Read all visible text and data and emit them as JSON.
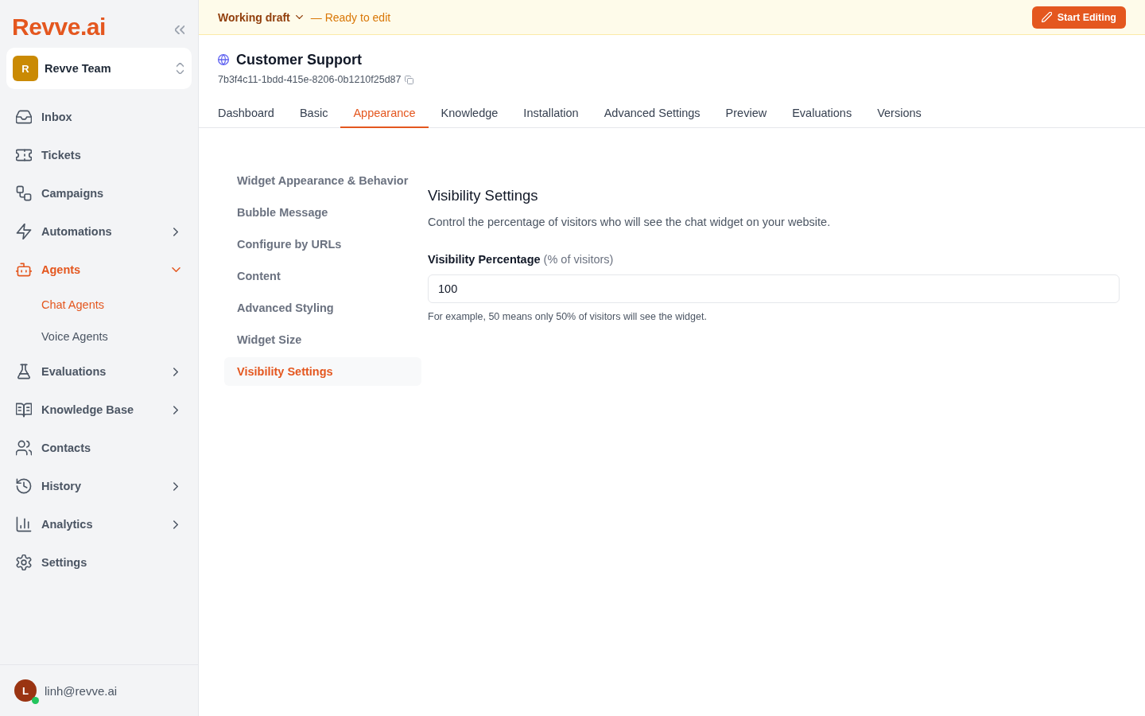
{
  "sidebar": {
    "logo": "Revve.ai",
    "workspace": {
      "initial": "R",
      "name": "Revve Team"
    },
    "items": [
      {
        "kind": "link",
        "label": "Inbox",
        "selected": false
      },
      {
        "kind": "link",
        "label": "Tickets",
        "selected": false
      },
      {
        "kind": "link",
        "label": "Campaigns",
        "selected": false
      },
      {
        "kind": "group",
        "label": "Automations",
        "selected": false,
        "expanded": false
      },
      {
        "kind": "group",
        "label": "Agents",
        "selected": true,
        "expanded": true,
        "children": [
          {
            "label": "Chat Agents",
            "selected": true
          },
          {
            "label": "Voice Agents",
            "selected": false
          }
        ]
      },
      {
        "kind": "group",
        "label": "Evaluations",
        "selected": false,
        "expanded": false
      },
      {
        "kind": "group",
        "label": "Knowledge Base",
        "selected": false,
        "expanded": false
      },
      {
        "kind": "link",
        "label": "Contacts",
        "selected": false
      },
      {
        "kind": "group",
        "label": "History",
        "selected": false,
        "expanded": false
      },
      {
        "kind": "group",
        "label": "Analytics",
        "selected": false,
        "expanded": false
      },
      {
        "kind": "link",
        "label": "Settings",
        "selected": false
      }
    ],
    "user": {
      "initial": "L",
      "email": "linh@revve.ai",
      "online": true
    }
  },
  "draft_bar": {
    "version": "Working draft",
    "status": "— Ready to edit",
    "action": "Start Editing"
  },
  "agent": {
    "name": "Customer Support",
    "id": "7b3f4c11-1bdd-415e-8206-0b1210f25d87"
  },
  "tabs": [
    {
      "label": "Dashboard",
      "selected": false
    },
    {
      "label": "Basic",
      "selected": false
    },
    {
      "label": "Appearance",
      "selected": true
    },
    {
      "label": "Knowledge",
      "selected": false
    },
    {
      "label": "Installation",
      "selected": false
    },
    {
      "label": "Advanced Settings",
      "selected": false
    },
    {
      "label": "Preview",
      "selected": false
    },
    {
      "label": "Evaluations",
      "selected": false
    },
    {
      "label": "Versions",
      "selected": false
    }
  ],
  "section_nav": [
    {
      "label": "Widget Appearance & Behavior",
      "selected": false
    },
    {
      "label": "Bubble Message",
      "selected": false
    },
    {
      "label": "Configure by URLs",
      "selected": false
    },
    {
      "label": "Content",
      "selected": false
    },
    {
      "label": "Advanced Styling",
      "selected": false
    },
    {
      "label": "Widget Size",
      "selected": false
    },
    {
      "label": "Visibility Settings",
      "selected": true
    }
  ],
  "panel": {
    "title": "Visibility Settings",
    "description": "Control the percentage of visitors who will see the chat widget on your website.",
    "field": {
      "label": "**Visibility Percentage** (% of visitors)",
      "value": "100",
      "help": "For example, 50 means only 50% of visitors will see the widget."
    }
  }
}
